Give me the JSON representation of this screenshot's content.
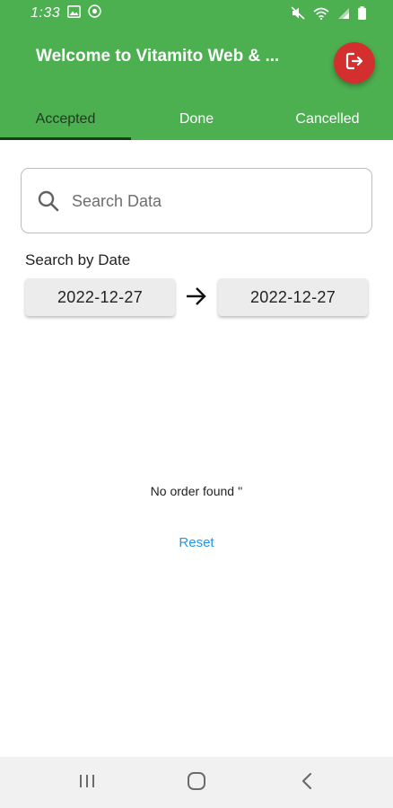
{
  "status_bar": {
    "time": "1:33",
    "left_icons": [
      "image-icon",
      "whatsapp-icon"
    ],
    "right_icons": [
      "mute-icon",
      "wifi-icon",
      "signal-icon",
      "battery-icon"
    ]
  },
  "app_bar": {
    "title": "Welcome to Vitamito Web & ...",
    "logout_icon": "logout-icon",
    "accent": "#4caf50",
    "logout_color": "#d32f2f"
  },
  "tabs": [
    {
      "label": "Accepted",
      "active": true
    },
    {
      "label": "Done",
      "active": false
    },
    {
      "label": "Cancelled",
      "active": false
    }
  ],
  "search": {
    "placeholder": "Search Data",
    "value": ""
  },
  "date_filter": {
    "label": "Search by Date",
    "from": "2022-12-27",
    "to": "2022-12-27"
  },
  "empty_state": {
    "message": "No order found ''",
    "reset_label": "Reset",
    "link_color": "#2196f3"
  },
  "nav_bar": {
    "buttons": [
      "recents-icon",
      "home-icon",
      "back-icon"
    ]
  }
}
